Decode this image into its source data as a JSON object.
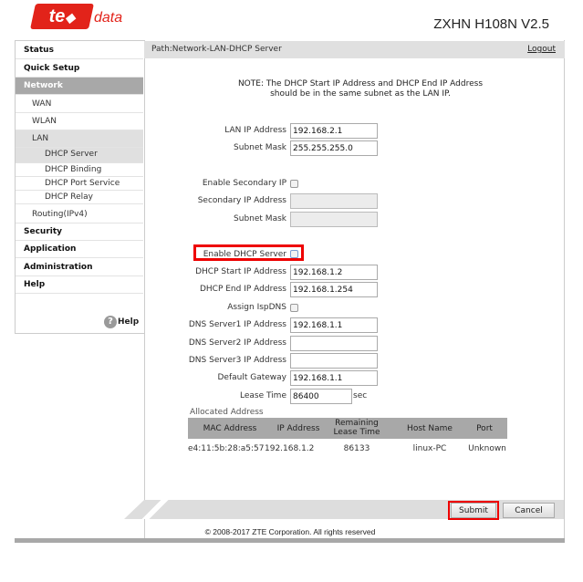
{
  "header": {
    "logo_text": "te data",
    "logo_main": "te",
    "logo_sub": "data",
    "model": "ZXHN H108N V2.5",
    "brand_color": "#e2231a"
  },
  "sidebar": {
    "items": [
      {
        "label": "Status",
        "level": 1
      },
      {
        "label": "Quick Setup",
        "level": 1
      },
      {
        "label": "Network",
        "level": 1,
        "active": true
      },
      {
        "label": "WAN",
        "level": 2
      },
      {
        "label": "WLAN",
        "level": 2
      },
      {
        "label": "LAN",
        "level": 2,
        "expanded": true
      },
      {
        "label": "DHCP Server",
        "level": 3,
        "selected": true
      },
      {
        "label": "DHCP Binding",
        "level": 3
      },
      {
        "label": "DHCP Port Service",
        "level": 3
      },
      {
        "label": "DHCP Relay",
        "level": 3
      },
      {
        "label": "Routing(IPv4)",
        "level": 2
      },
      {
        "label": "Security",
        "level": 1
      },
      {
        "label": "Application",
        "level": 1
      },
      {
        "label": "Administration",
        "level": 1
      },
      {
        "label": "Help",
        "level": 1
      }
    ],
    "help_label": "Help",
    "help_icon": "question-circle-icon"
  },
  "main": {
    "path": "Path:Network-LAN-DHCP Server",
    "logout": "Logout",
    "note_line1": "NOTE: The DHCP Start IP Address and DHCP End IP Address",
    "note_line2": "should be in the same subnet as the LAN IP.",
    "fields": {
      "lan_ip": {
        "label": "LAN IP Address",
        "value": "192.168.2.1"
      },
      "subnet": {
        "label": "Subnet Mask",
        "value": "255.255.255.0"
      },
      "enable_secondary": {
        "label": "Enable Secondary IP",
        "checked": false
      },
      "secondary_ip": {
        "label": "Secondary IP Address",
        "value": ""
      },
      "secondary_mask": {
        "label": "Subnet Mask",
        "value": ""
      },
      "enable_dhcp": {
        "label": "Enable DHCP Server",
        "checked": false
      },
      "dhcp_start": {
        "label": "DHCP Start IP Address",
        "value": "192.168.1.2"
      },
      "dhcp_end": {
        "label": "DHCP End IP Address",
        "value": "192.168.1.254"
      },
      "assign_isp_dns": {
        "label": "Assign IspDNS",
        "checked": false
      },
      "dns1": {
        "label": "DNS Server1 IP Address",
        "value": "192.168.1.1"
      },
      "dns2": {
        "label": "DNS Server2 IP Address",
        "value": ""
      },
      "dns3": {
        "label": "DNS Server3 IP Address",
        "value": ""
      },
      "gateway": {
        "label": "Default Gateway",
        "value": "192.168.1.1"
      },
      "lease": {
        "label": "Lease Time",
        "value": "86400",
        "unit": "sec"
      }
    },
    "allocated": {
      "title": "Allocated Address",
      "headers": [
        "MAC Address",
        "IP Address",
        "Remaining Lease Time",
        "Host Name",
        "Port"
      ],
      "rows": [
        [
          "e4:11:5b:28:a5:57",
          "192.168.1.2",
          "86133",
          "linux-PC",
          "Unknown"
        ]
      ]
    },
    "submit": "Submit",
    "cancel": "Cancel",
    "highlight_color": "#ee0000"
  },
  "footer": {
    "copyright": "© 2008-2017 ZTE Corporation. All rights reserved"
  }
}
